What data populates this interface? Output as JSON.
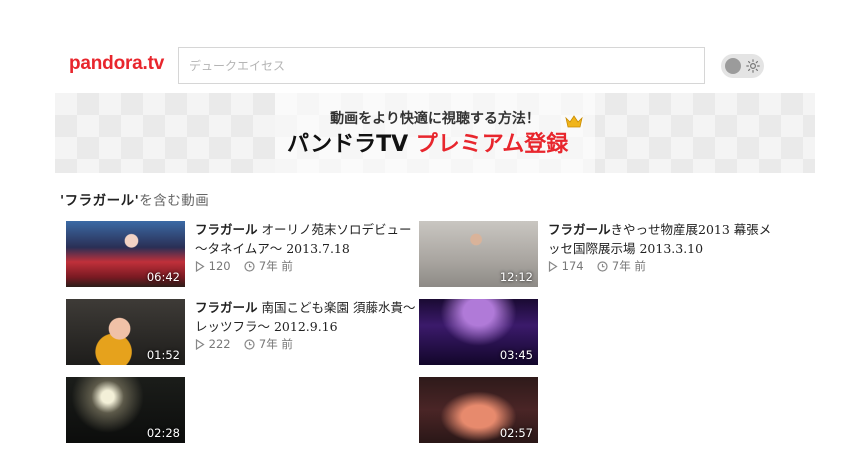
{
  "header": {
    "logo": "pandora.tv",
    "search": {
      "placeholder": "デュークエイセス",
      "value": ""
    },
    "theme_toggle": {
      "state": "off"
    }
  },
  "banner": {
    "line1": "動画をより快適に視聴する方法！",
    "line2_part1": "パンドラTV ",
    "line2_part2": "プレミアム登録"
  },
  "results": {
    "heading_query": "'フラガール'",
    "heading_suffix": "を含む動画",
    "videos": [
      {
        "duration": "06:42",
        "title_highlight": "フラガール",
        "title_rest": " オーリノ苑末ソロデビュー～タネイムア～ 2013.7.18",
        "views": "120",
        "age": "7年 前"
      },
      {
        "duration": "12:12",
        "title_highlight": "フラガール",
        "title_rest": "きやっせ物産展2013 幕張メッセ国際展示場 2013.3.10",
        "views": "174",
        "age": "7年 前"
      },
      {
        "duration": "01:52",
        "title_highlight": "フラガール",
        "title_rest": " 南国こども楽園 須藤水貴～レッツフラ～ 2012.9.16",
        "views": "222",
        "age": "7年 前"
      },
      {
        "duration": "03:45"
      },
      {
        "duration": "02:28"
      },
      {
        "duration": "02:57"
      }
    ]
  },
  "colors": {
    "brand": "#e8262d",
    "meta_text": "#777777"
  }
}
